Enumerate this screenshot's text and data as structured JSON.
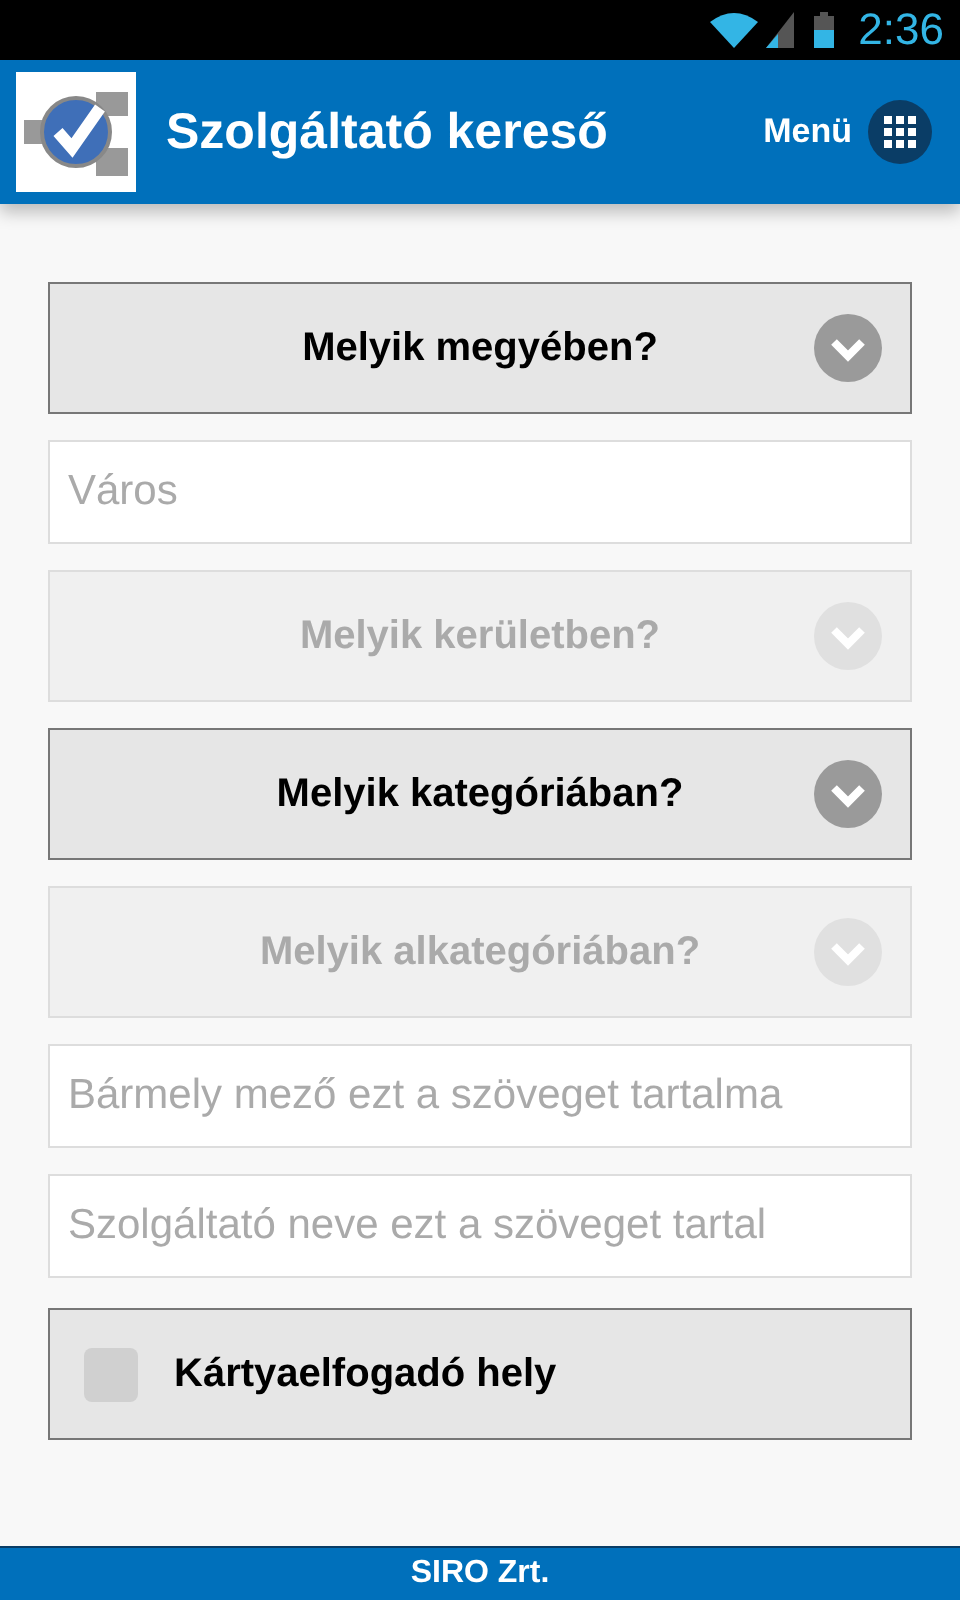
{
  "status_bar": {
    "time": "2:36"
  },
  "header": {
    "title": "Szolgáltató kereső",
    "menu_label": "Menü"
  },
  "form": [
    {
      "kind": "select",
      "label": "Melyik megyében?",
      "disabled": false
    },
    {
      "kind": "input",
      "placeholder": "Város"
    },
    {
      "kind": "select",
      "label": "Melyik kerületben?",
      "disabled": true
    },
    {
      "kind": "select",
      "label": "Melyik kategóriában?",
      "disabled": false
    },
    {
      "kind": "select",
      "label": "Melyik alkategóriában?",
      "disabled": true
    },
    {
      "kind": "input",
      "placeholder": "Bármely mező ezt a szöveget tartalma"
    },
    {
      "kind": "input",
      "placeholder": "Szolgáltató neve ezt a szöveget tartal"
    },
    {
      "kind": "checkbox",
      "label": "Kártyaelfogadó hely",
      "checked": false
    }
  ],
  "footer": {
    "text": "SIRO Zrt."
  }
}
